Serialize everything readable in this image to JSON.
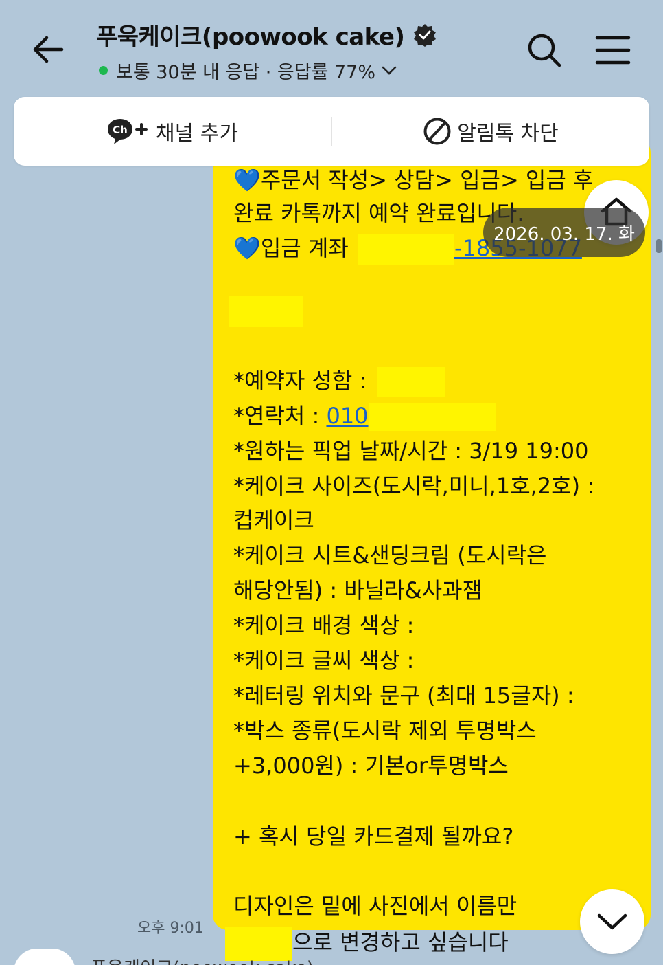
{
  "header": {
    "title": "푸욱케이크(poowook cake)",
    "status": "보통 30분 내 응답 · 응답률 77%"
  },
  "channel_bar": {
    "add_label": "채널 추가",
    "block_label": "알림톡 차단"
  },
  "date_chip": "2026. 03. 17. 화",
  "message": {
    "partial_top": "💙주문서 작성> 상담> 입금> 입금 후",
    "line_complete": "완료 카톡까지 예약 완료입니다.",
    "account_label": "입금 계좌",
    "account_number": "-1855-1077",
    "name_label": "*예약자 성함 :",
    "phone_label": "*연락처 :",
    "phone_prefix": "010",
    "pickup": "*원하는 픽업 날짜/시간 : 3/19 19:00",
    "size_label": "*케이크 사이즈(도시락,미니,1호,2호) :",
    "size_value": "컵케이크",
    "sheet_label": "*케이크 시트&샌딩크림 (도시락은",
    "sheet_value": "해당안됨) : 바닐라&사과잼",
    "bg_color": "*케이크 배경 색상 :",
    "text_color": "*케이크 글씨 색상 :",
    "lettering": "*레터링 위치와 문구 (최대 15글자) :",
    "box_label": "*박스 종류(도시락 제외 투명박스",
    "box_value": "+3,000원) : 기본or투명박스",
    "card_question": "+ 혹시 당일 카드결제 될까요?",
    "design_line1": "디자인은 밑에 사진에서 이름만",
    "design_line2": "으로 변경하고 싶습니다",
    "time": "오후 9:01"
  },
  "next_message": {
    "sender": "푸욱케이크(poowook cake)"
  },
  "colors": {
    "background": "#b2c7d9",
    "bubble": "#fee500",
    "online": "#1db84f",
    "link": "#1a62c7"
  },
  "icons": [
    "back-arrow-icon",
    "verified-badge-icon",
    "chevron-down-icon",
    "search-icon",
    "menu-icon",
    "channel-add-icon",
    "block-icon",
    "heart-icon",
    "home-icon",
    "scroll-down-icon"
  ]
}
